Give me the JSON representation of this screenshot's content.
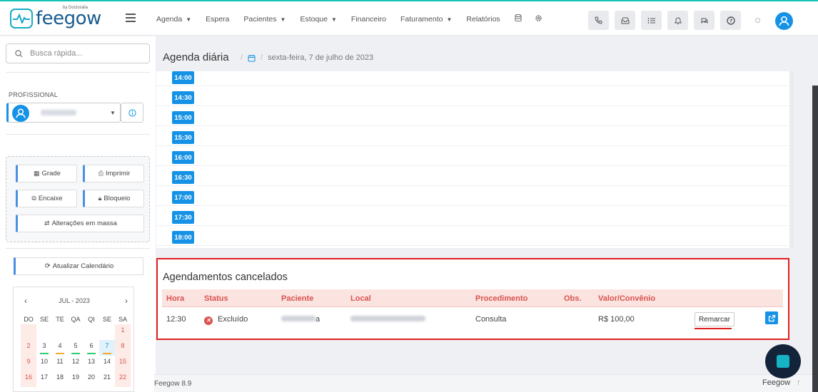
{
  "app": {
    "logo_text": "feegow",
    "logo_sub": "by Doctoralia"
  },
  "nav": {
    "items": [
      {
        "label": "Agenda",
        "caret": true
      },
      {
        "label": "Espera",
        "caret": false
      },
      {
        "label": "Pacientes",
        "caret": true
      },
      {
        "label": "Estoque",
        "caret": true
      },
      {
        "label": "Financeiro",
        "caret": false
      },
      {
        "label": "Faturamento",
        "caret": true
      },
      {
        "label": "Relatórios",
        "caret": false
      }
    ],
    "extra_icons": [
      "database-icon",
      "gear-icon"
    ],
    "toolbar_icons": [
      "phone-icon",
      "inbox-icon",
      "list-icon",
      "bell-icon",
      "chat-icon",
      "help-icon"
    ]
  },
  "sidebar": {
    "search_placeholder": "Busca rápida...",
    "profissional_label": "PROFISSIONAL",
    "buttons": {
      "grade": "Grade",
      "imprimir": "Imprimir",
      "encaixe": "Encaixe",
      "bloqueio": "Bloqueio",
      "alteracoes": "Alterações em massa"
    },
    "refresh": "Atualizar Calendário",
    "calendar": {
      "title": "JUL - 2023",
      "weekdays": [
        "DO",
        "SE",
        "TE",
        "QA",
        "QI",
        "SE",
        "SA"
      ],
      "rows": [
        [
          "",
          "",
          "",
          "",
          "",
          "",
          "1"
        ],
        [
          "2",
          "3",
          "4",
          "5",
          "6",
          "7",
          "8"
        ],
        [
          "9",
          "10",
          "11",
          "12",
          "13",
          "14",
          "15"
        ],
        [
          "16",
          "17",
          "18",
          "19",
          "20",
          "21",
          "22"
        ]
      ],
      "today": "7"
    }
  },
  "page": {
    "title": "Agenda diária",
    "date": "sexta-feira, 7 de julho de 2023",
    "slots": [
      "14:00",
      "14:30",
      "15:00",
      "15:30",
      "16:00",
      "16:30",
      "17:00",
      "17:30",
      "18:00"
    ]
  },
  "cancelled": {
    "heading": "Agendamentos cancelados",
    "columns": {
      "hora": "Hora",
      "status": "Status",
      "paciente": "Paciente",
      "local": "Local",
      "procedimento": "Procedimento",
      "obs": "Obs.",
      "valor": "Valor/Convênio"
    },
    "row": {
      "hora": "12:30",
      "status": "Excluído",
      "paciente_suffix": "a",
      "procedimento": "Consulta",
      "valor": "R$ 100,00",
      "action": "Remarcar"
    }
  },
  "footer": {
    "left": "Feegow 8.9",
    "right": "Feegow"
  },
  "colors": {
    "accent": "#1592e6",
    "danger": "#e01f1f",
    "teal": "#13c4b4"
  }
}
